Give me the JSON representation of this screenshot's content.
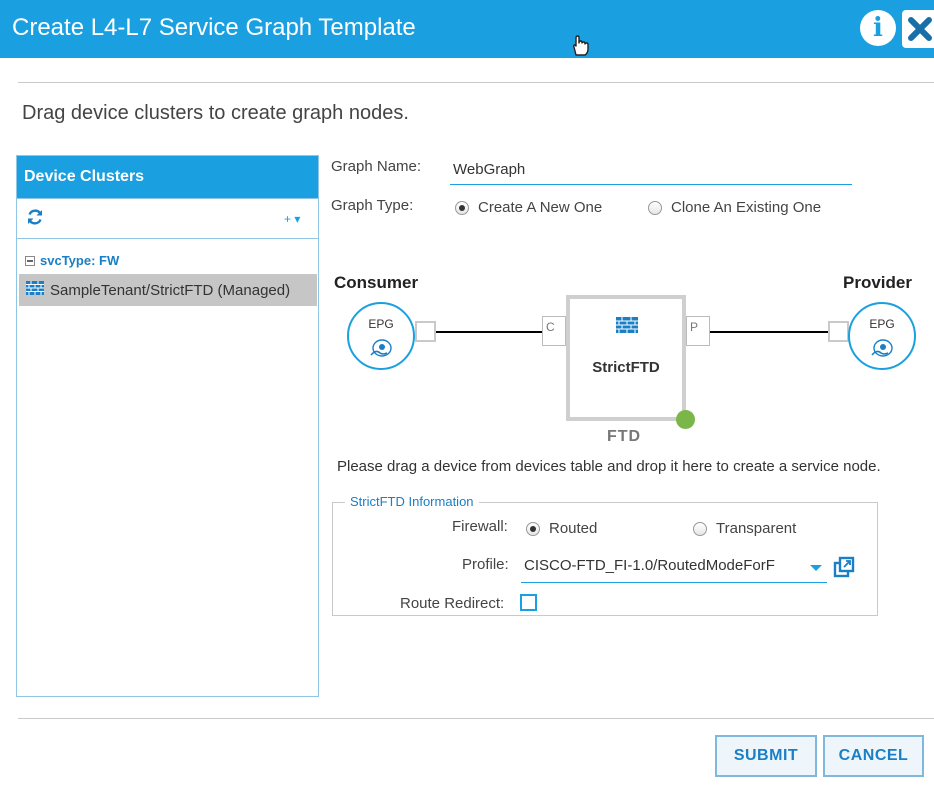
{
  "dialog": {
    "title": "Create L4-L7 Service Graph Template"
  },
  "instruction": "Drag device clusters to create graph nodes.",
  "device_clusters": {
    "header": "Device Clusters",
    "group_label": "svcType: FW",
    "items": [
      {
        "label": "SampleTenant/StrictFTD (Managed)"
      }
    ],
    "add_label": "+ ▾"
  },
  "form": {
    "graph_name_label": "Graph Name:",
    "graph_name_value": "WebGraph",
    "graph_type_label": "Graph Type:",
    "graph_type_options": [
      "Create A New One",
      "Clone An Existing One"
    ],
    "graph_type_selected": "Create A New One"
  },
  "diagram": {
    "consumer_label": "Consumer",
    "provider_label": "Provider",
    "epg_label": "EPG",
    "port_c": "C",
    "port_p": "P",
    "node_name": "StrictFTD",
    "node_type": "FTD",
    "node_status_color": "#7ab648",
    "drag_hint": "Please drag a device from devices table and drop it here to create a service node."
  },
  "info_section": {
    "legend": "StrictFTD Information",
    "firewall_label": "Firewall:",
    "firewall_options": [
      "Routed",
      "Transparent"
    ],
    "firewall_selected": "Routed",
    "profile_label": "Profile:",
    "profile_value": "CISCO-FTD_FI-1.0/RoutedModeForF",
    "route_redirect_label": "Route Redirect:",
    "route_redirect_checked": false
  },
  "buttons": {
    "submit": "SUBMIT",
    "cancel": "CANCEL"
  },
  "colors": {
    "accent": "#1aa0e0",
    "link": "#1a7fc4"
  }
}
